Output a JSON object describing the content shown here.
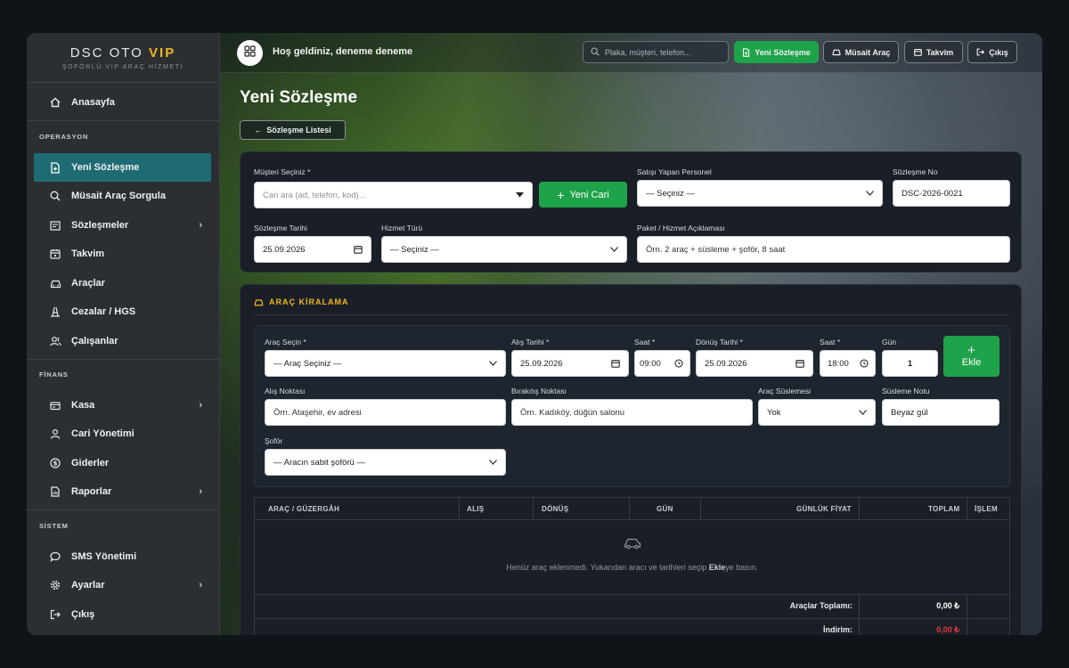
{
  "sidebar": {
    "brand": {
      "name": "DSC OTO",
      "highlight": "VIP",
      "subtitle": "ŞOFÖRLÜ VIP ARAÇ HİZMETİ"
    },
    "home": {
      "label": "Anasayfa",
      "icon": "home-icon"
    },
    "sections": [
      {
        "title": "OPERASYON",
        "items": [
          {
            "label": "Yeni Sözleşme",
            "icon": "file-plus-icon",
            "active": true
          },
          {
            "label": "Müsait Araç Sorgula",
            "icon": "search-icon"
          },
          {
            "label": "Sözleşmeler",
            "icon": "contract-icon",
            "chevron": true
          },
          {
            "label": "Takvim",
            "icon": "calendar-icon"
          },
          {
            "label": "Araçlar",
            "icon": "car-icon"
          },
          {
            "label": "Cezalar / HGS",
            "icon": "road-icon"
          },
          {
            "label": "Çalışanlar",
            "icon": "users-icon"
          }
        ]
      },
      {
        "title": "FİNANS",
        "items": [
          {
            "label": "Kasa",
            "icon": "wallet-icon",
            "chevron": true
          },
          {
            "label": "Cari Yönetimi",
            "icon": "user-icon"
          },
          {
            "label": "Giderler",
            "icon": "dollar-circle-icon"
          },
          {
            "label": "Raporlar",
            "icon": "report-icon",
            "chevron": true
          }
        ]
      },
      {
        "title": "SİSTEM",
        "items": [
          {
            "label": "SMS Yönetimi",
            "icon": "chat-icon"
          },
          {
            "label": "Ayarlar",
            "icon": "gear-icon",
            "chevron": true
          },
          {
            "label": "Çıkış",
            "icon": "logout-icon"
          }
        ]
      }
    ]
  },
  "topbar": {
    "welcome": "Hoş geldiniz, deneme deneme",
    "search_placeholder": "Plaka, müşteri, telefon...",
    "buttons": {
      "new_contract": "Yeni Sözleşme",
      "available": "Müsait Araç",
      "calendar": "Takvim",
      "logout": "Çıkış"
    }
  },
  "page": {
    "title": "Yeni Sözleşme",
    "back_label": "Sözleşme Listesi"
  },
  "customer_form": {
    "customer_label": "Müşteri Seçiniz *",
    "customer_placeholder": "Cari ara (ad, telefon, kod)...",
    "new_customer_button": "Yeni Cari",
    "staff_label": "Satışı Yapan Personel",
    "staff_value": "— Seçiniz —",
    "contract_no_label": "Sözleşme No",
    "contract_no_value": "DSC-2026-0021",
    "date_label": "Sözleşme Tarihi",
    "date_value": "25.09.2026",
    "service_label": "Hizmet Türü",
    "service_value": "— Seçiniz —",
    "package_label": "Paket / Hizmet Açıklaması",
    "package_placeholder": "Örn. 2 araç + süsleme + şoför, 8 saat"
  },
  "rental": {
    "title": "ARAÇ KİRALAMA",
    "vehicle_label": "Araç Seçin *",
    "vehicle_value": "— Araç Seçiniz —",
    "pickup_date_label": "Alış Tarihi *",
    "pickup_date_value": "25.09.2026",
    "pickup_time_label": "Saat *",
    "pickup_time_value": "09:00",
    "return_date_label": "Dönüş Tarihi *",
    "return_date_value": "25.09.2026",
    "return_time_label": "Saat *",
    "return_time_value": "18:00",
    "days_label": "Gün",
    "days_value": "1",
    "add_button_plus": "+",
    "add_button": "Ekle",
    "pickup_point_label": "Alış Noktası",
    "pickup_point_placeholder": "Örn. Ataşehir, ev adresi",
    "drop_point_label": "Bırakılış Noktası",
    "drop_point_placeholder": "Örn. Kadıköy, düğün salonu",
    "decoration_label": "Araç Süslemesi",
    "decoration_value": "Yok",
    "decoration_note_label": "Süsleme Notu",
    "decoration_note_value": "Beyaz gül",
    "driver_label": "Şoför",
    "driver_value": "— Aracın sabit şoförü —"
  },
  "table": {
    "headers": [
      "ARAÇ / GÜZERGÂH",
      "ALIŞ",
      "DÖNÜŞ",
      "GÜN",
      "GÜNLÜK FİYAT",
      "TOPLAM",
      "İŞLEM"
    ],
    "empty_before": "Henüz araç eklenmedi. Yukarıdan aracı ve tarihleri seçip ",
    "empty_bold": "Ekle",
    "empty_after": "ye basın.",
    "totals": [
      {
        "label": "Araçlar Toplamı:",
        "value": "0,00 ₺",
        "color": "#ffffff"
      },
      {
        "label": "İndirim:",
        "value": "0,00 ₺",
        "color": "#e0393e"
      }
    ]
  },
  "colors": {
    "accent_green": "#1fa34a",
    "brand_gold": "#f2b61f",
    "active_nav": "#1f6b74"
  }
}
